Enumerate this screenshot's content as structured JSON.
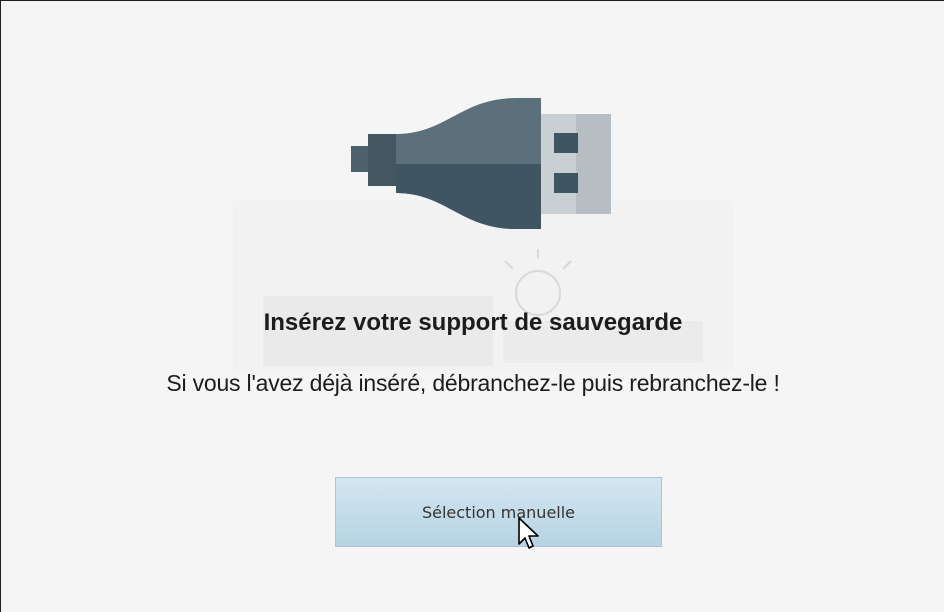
{
  "dialog": {
    "title": "Insérez votre support de sauvegarde",
    "message": "Si vous l'avez déjà inséré, débranchez-le puis rebranchez-le !",
    "manual_selection_label": "Sélection manuelle"
  },
  "icons": {
    "main": "usb-drive-icon",
    "pointer": "mouse-pointer-icon"
  },
  "colors": {
    "background": "#f5f5f5",
    "usb_body_dark": "#3f5662",
    "usb_body_light": "#5b707b",
    "usb_connector": "#c9d0d4",
    "button_top": "#d3e6f0",
    "button_bottom": "#b6d3e2",
    "text": "#1c1c1c"
  }
}
